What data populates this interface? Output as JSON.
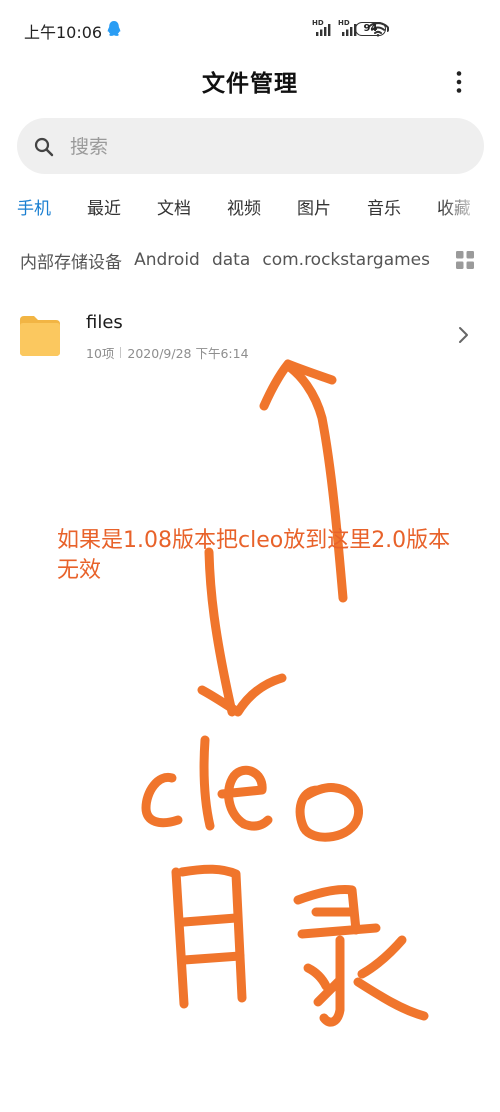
{
  "status_bar": {
    "time": "上午10:06",
    "battery": "94",
    "hd_label": "HD"
  },
  "header": {
    "title": "文件管理"
  },
  "search": {
    "placeholder": "搜索"
  },
  "tabs": [
    {
      "label": "手机",
      "active": true
    },
    {
      "label": "最近",
      "active": false
    },
    {
      "label": "文档",
      "active": false
    },
    {
      "label": "视频",
      "active": false
    },
    {
      "label": "图片",
      "active": false
    },
    {
      "label": "音乐",
      "active": false
    },
    {
      "label": "收藏",
      "active": false
    }
  ],
  "breadcrumb": [
    "内部存储设备",
    "Android",
    "data",
    "com.rockstargames"
  ],
  "files": [
    {
      "name": "files",
      "count": "10项",
      "date": "2020/9/28 下午6:14"
    }
  ],
  "annotation": {
    "note": "如果是1.08版本把cleo放到这里2.0版本无效"
  },
  "colors": {
    "accent": "#1a7fd1",
    "annotation": "#e8622a",
    "folder": "#f9c35b"
  }
}
